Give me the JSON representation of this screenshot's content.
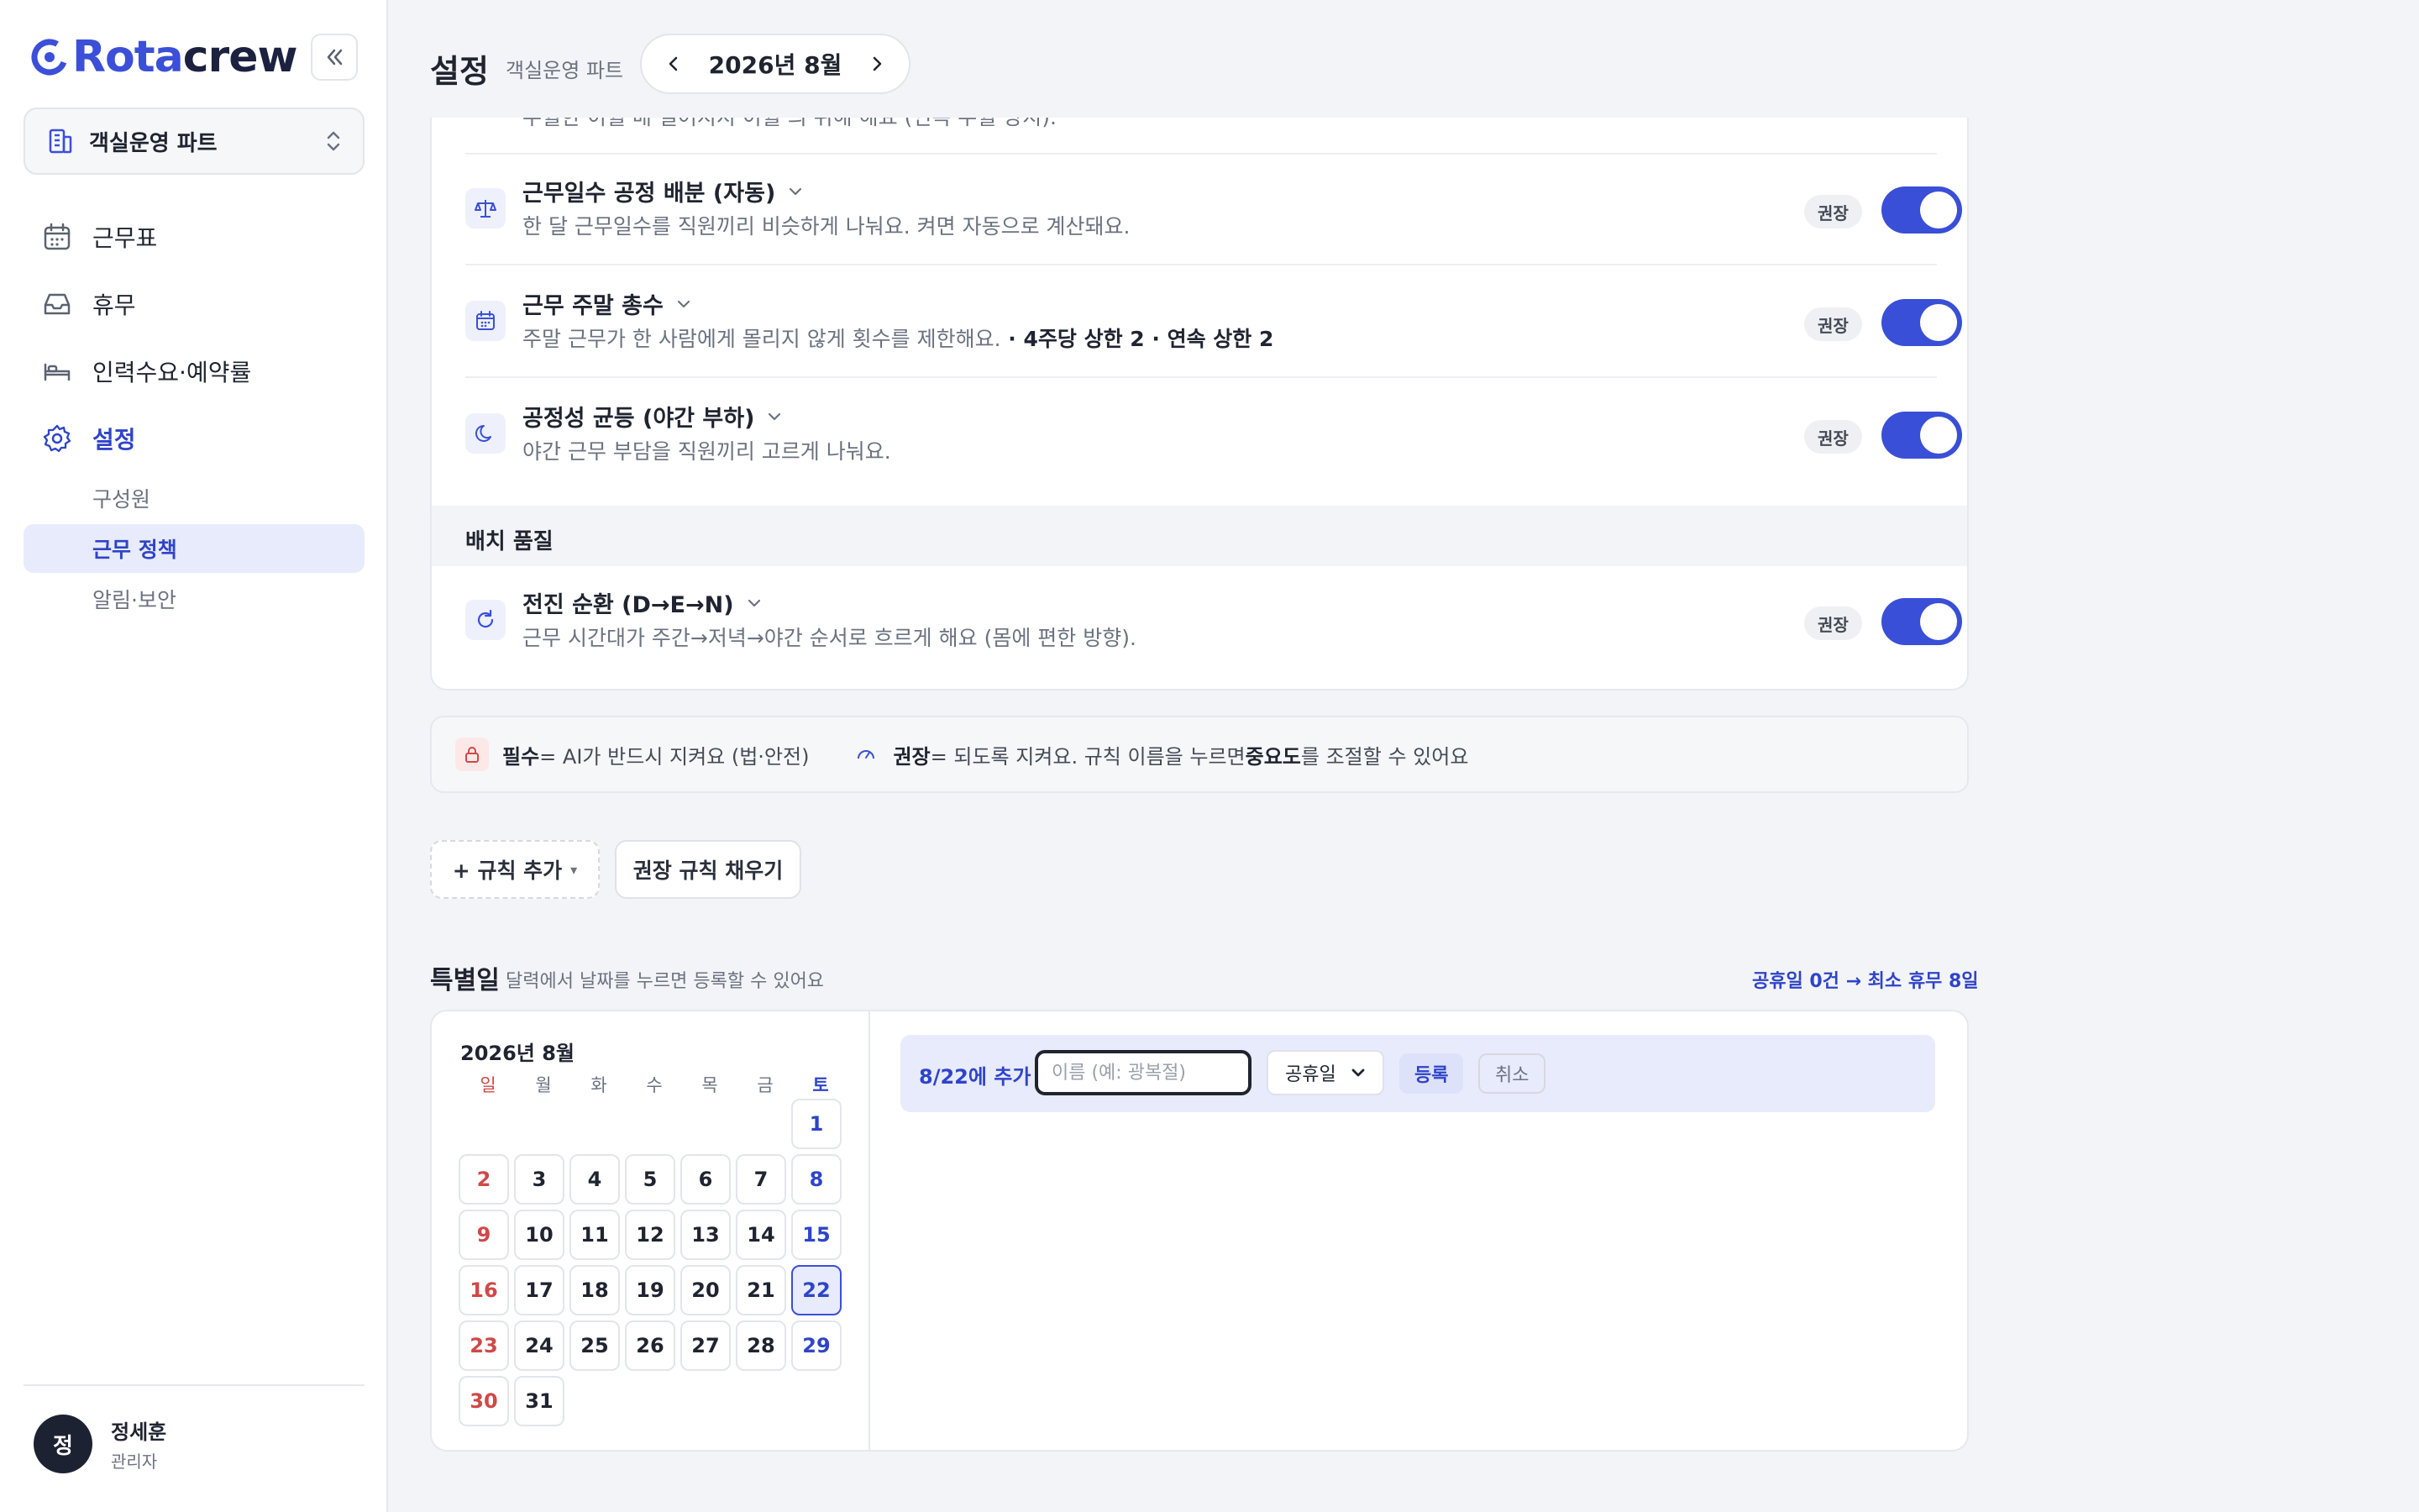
{
  "brand": {
    "part1": "Rota",
    "part2": "crew"
  },
  "sidebar": {
    "team": "객실운영 파트",
    "nav": [
      {
        "label": "근무표",
        "icon": "calendar-icon"
      },
      {
        "label": "휴무",
        "icon": "inbox-icon"
      },
      {
        "label": "인력수요·예약률",
        "icon": "bed-icon"
      },
      {
        "label": "설정",
        "icon": "gear-icon",
        "active": true
      }
    ],
    "subnav": [
      {
        "label": "구성원"
      },
      {
        "label": "근무 정책",
        "active": true
      },
      {
        "label": "알림·보안"
      }
    ],
    "user": {
      "initial": "정",
      "name": "정세훈",
      "role": "관리자"
    }
  },
  "header": {
    "title": "설정",
    "subtitle": "객실운영 파트",
    "month": "2026년 8월"
  },
  "rules": {
    "partial_desc": "우월한 이월 배 일어지지 이월 의 위해 해요 (연속 우월 방지).",
    "items": [
      {
        "title": "근무일수 공정 배분 (자동)",
        "desc": "한 달 근무일수를 직원끼리 비슷하게 나눠요. 켜면 자동으로 계산돼요.",
        "badge": "권장",
        "icon": "scale-icon"
      },
      {
        "title": "근무 주말 총수",
        "desc": "주말 근무가 한 사람에게 몰리지 않게 횟수를 제한해요.",
        "desc_bold": " · 4주당 상한 2 · 연속 상한 2",
        "badge": "권장",
        "icon": "calendar-icon"
      },
      {
        "title": "공정성 균등 (야간 부하)",
        "desc": "야간 근무 부담을 직원끼리 고르게 나눠요.",
        "badge": "권장",
        "icon": "moon-icon"
      }
    ],
    "section": "배치 품질",
    "quality": {
      "title": "전진 순환 (D→E→N)",
      "desc": "근무 시간대가 주간→저녁→야간 순서로 흐르게 해요 (몸에 편한 방향).",
      "badge": "권장",
      "icon": "refresh-icon"
    }
  },
  "legend": {
    "required_label": "필수",
    "required_text": " = AI가 반드시 지켜요 (법·안전)",
    "recommend_label": "권장",
    "recommend_text_1": " = 되도록 지켜요. 규칙 이름을 누르면 ",
    "recommend_bold": "중요도",
    "recommend_text_2": "를 조절할 수 있어요"
  },
  "actions": {
    "add_rule": "+ 규칙 추가",
    "add_rule_arrow": "▾",
    "fill_recommended": "권장 규칙 채우기"
  },
  "special_days": {
    "title": "특별일",
    "subtitle": "달력에서 날짜를 누르면 등록할 수 있어요",
    "summary": "공휴일 0건 → 최소 휴무 8일",
    "calendar": {
      "title": "2026년 8월",
      "weekdays": [
        "일",
        "월",
        "화",
        "수",
        "목",
        "금",
        "토"
      ],
      "first_weekday": 6,
      "days": 31,
      "selected": 22
    },
    "add_form": {
      "label": "8/22에 추가",
      "placeholder": "이름 (예: 광복절)",
      "type_value": "공휴일",
      "register": "등록",
      "cancel": "취소"
    }
  },
  "colors": {
    "accent": "#3a4fd7",
    "sunday": "#d04848",
    "saturday": "#2f44c9"
  }
}
